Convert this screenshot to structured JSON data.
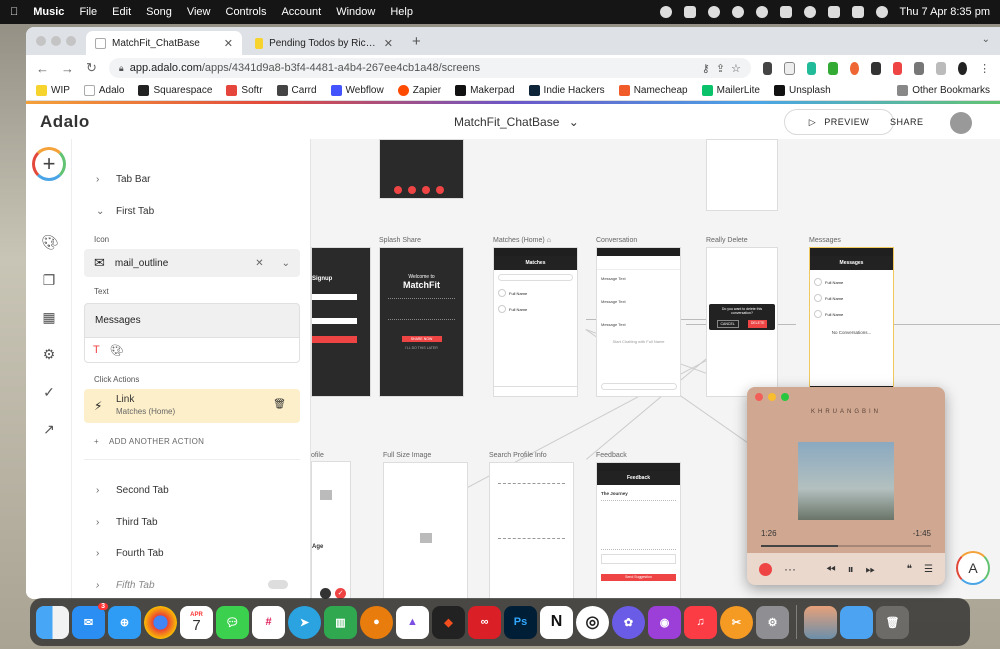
{
  "menubar": {
    "app": "Music",
    "items": [
      "File",
      "Edit",
      "Song",
      "View",
      "Controls",
      "Account",
      "Window",
      "Help"
    ],
    "datetime": "Thu 7 Apr  8:35 pm"
  },
  "browser": {
    "tabs": [
      {
        "title": "MatchFit_ChatBase",
        "favicon_color": "#ffffff"
      },
      {
        "title": "Pending Todos by Rich Taylor | ...",
        "favicon_color": "#f6d32d"
      }
    ],
    "url_host": "app.adalo.com",
    "url_path": "/apps/4341d9a8-b3f4-4481-a4b4-267ee4cb1a48/screens",
    "bookmarks": [
      "WIP",
      "Adalo",
      "Squarespace",
      "Softr",
      "Carrd",
      "Webflow",
      "Zapier",
      "Makerpad",
      "Indie Hackers",
      "Namecheap",
      "MailerLite",
      "Unsplash"
    ],
    "other_bookmarks": "Other Bookmarks"
  },
  "adalo": {
    "logo": "Adalo",
    "app_name": "MatchFit_ChatBase",
    "preview_label": "PREVIEW",
    "share_label": "SHARE"
  },
  "panel": {
    "tab_bar": "Tab Bar",
    "first_tab": "First Tab",
    "icon_label": "Icon",
    "icon_value": "mail_outline",
    "text_label": "Text",
    "text_value": "Messages",
    "click_actions_label": "Click Actions",
    "action_name": "Link",
    "action_target": "Matches (Home)",
    "add_action": "ADD ANOTHER ACTION",
    "second_tab": "Second Tab",
    "third_tab": "Third Tab",
    "fourth_tab": "Fourth Tab",
    "fifth_tab": "Fifth Tab"
  },
  "screens": {
    "splash_share": "Splash Share",
    "matches_home": "Matches (Home)",
    "conversation": "Conversation",
    "really_delete": "Really Delete",
    "messages": "Messages",
    "profile": "ofile",
    "full_size_image": "Full Size Image",
    "search_profile_info": "Search Profile Info",
    "feedback": "Feedback",
    "matchfit_logo": "MatchFit",
    "welcome": "Welcome to",
    "matches_header": "Matches",
    "messages_header": "Messages",
    "feedback_header": "Feedback",
    "full_name": "Full Name",
    "delete_prompt": "Do you want to delete this conversation?",
    "cancel": "CANCEL",
    "delete": "DELETE",
    "no_conversations": "No Conversations...",
    "share_now": "SHARE NOW",
    "do_this_later": "I'LL DO THIS LATER",
    "send_suggestion": "Send Suggestion",
    "the_journey": "The Journey",
    "message_text": "Message Text",
    "start_chatting": "Start Chatting with Full Name",
    "age": "Age",
    "signup": "Signup"
  },
  "player": {
    "album_title": "KHRUANGBIN",
    "elapsed": "1:26",
    "remaining": "-1:45",
    "progress": 0.45
  },
  "dock": {
    "mail_badge": "3",
    "calendar_month": "APR",
    "calendar_day": "7"
  }
}
